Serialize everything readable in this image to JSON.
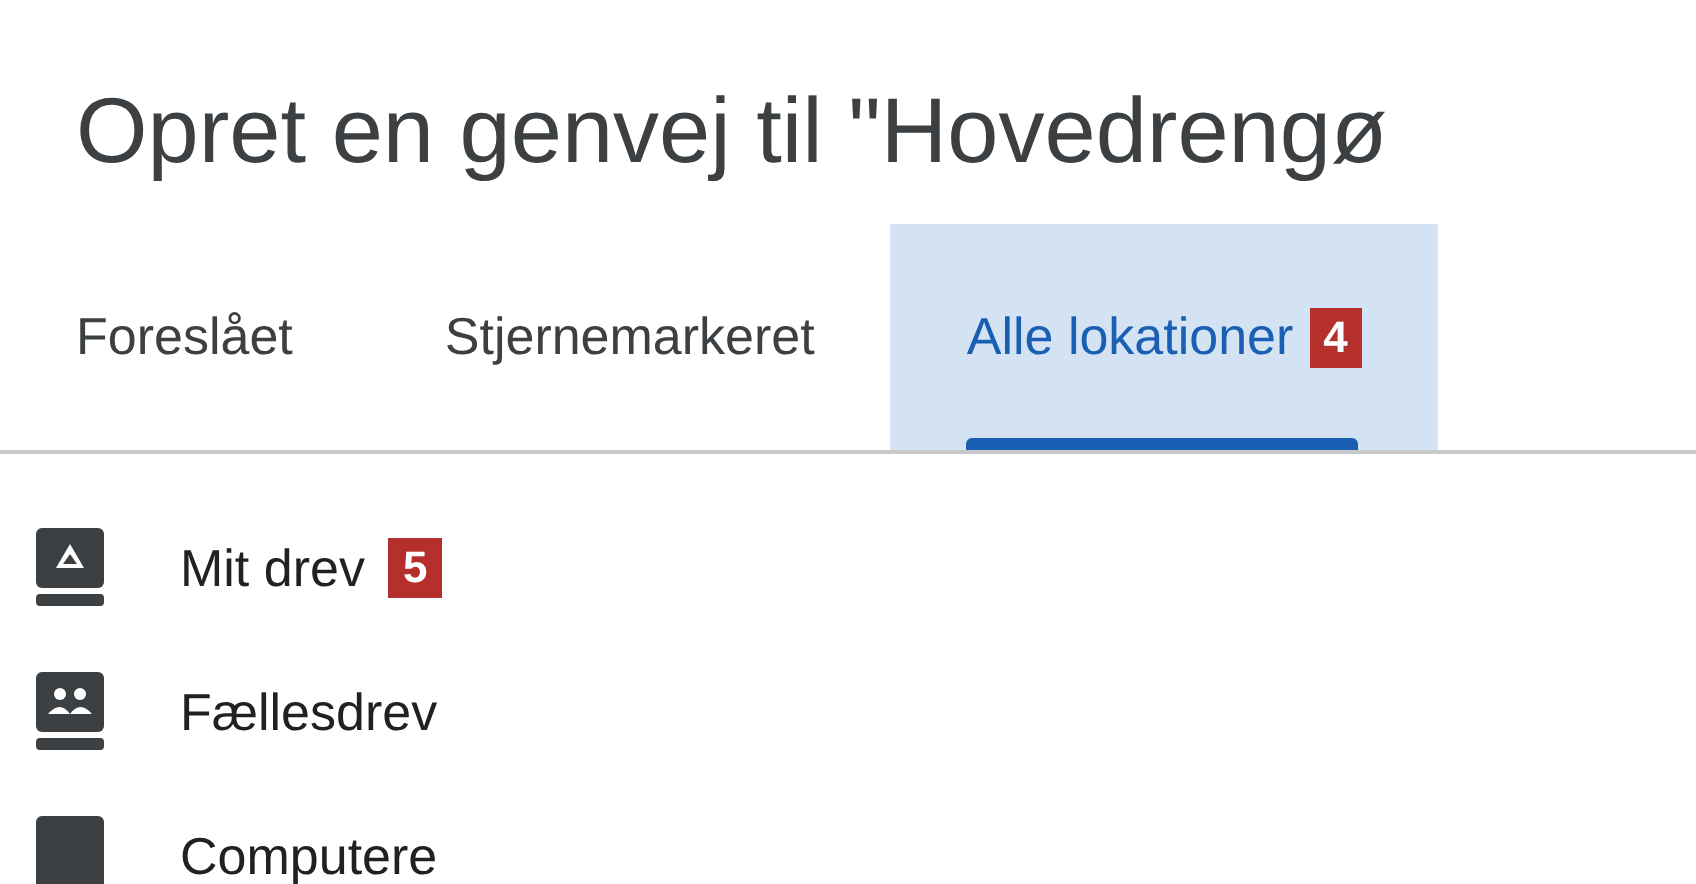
{
  "title": "Opret en genvej til \"Hovedrengø",
  "tabs": [
    {
      "label": "Foreslået",
      "selected": false
    },
    {
      "label": "Stjernemarkeret",
      "selected": false
    },
    {
      "label": "Alle lokationer",
      "selected": true,
      "badge": "4"
    }
  ],
  "locations": [
    {
      "kind": "drive",
      "label": "Mit drev",
      "badge": "5"
    },
    {
      "kind": "shared",
      "label": "Fællesdrev"
    },
    {
      "kind": "computer",
      "label": "Computere"
    }
  ]
}
